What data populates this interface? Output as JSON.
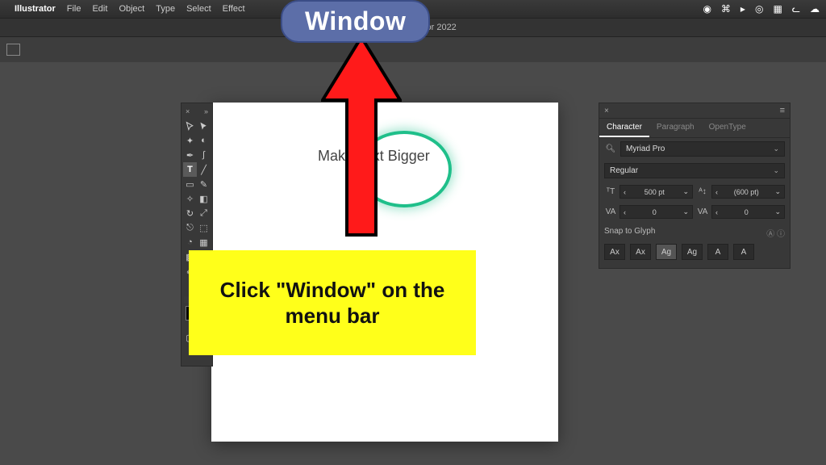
{
  "menubar": {
    "app": "Illustrator",
    "items": [
      "File",
      "Edit",
      "Object",
      "Type",
      "Select",
      "Effect"
    ]
  },
  "doc_title": "Adobe Illustrator 2022",
  "callout": {
    "label": "Window"
  },
  "instruction": "Click \"Window\" on the menu bar",
  "canvas": {
    "text": "Make Text Bigger"
  },
  "char_panel": {
    "tabs": [
      "Character",
      "Paragraph",
      "OpenType"
    ],
    "font_family": "Myriad Pro",
    "font_style": "Regular",
    "size": "500 pt",
    "leading": "(600 pt)",
    "kerning": "0",
    "tracking": "0",
    "snap_label": "Snap to Glyph",
    "snap_buttons": [
      "Ax",
      "Ax",
      "Ag",
      "Ag",
      "A",
      "A"
    ]
  }
}
